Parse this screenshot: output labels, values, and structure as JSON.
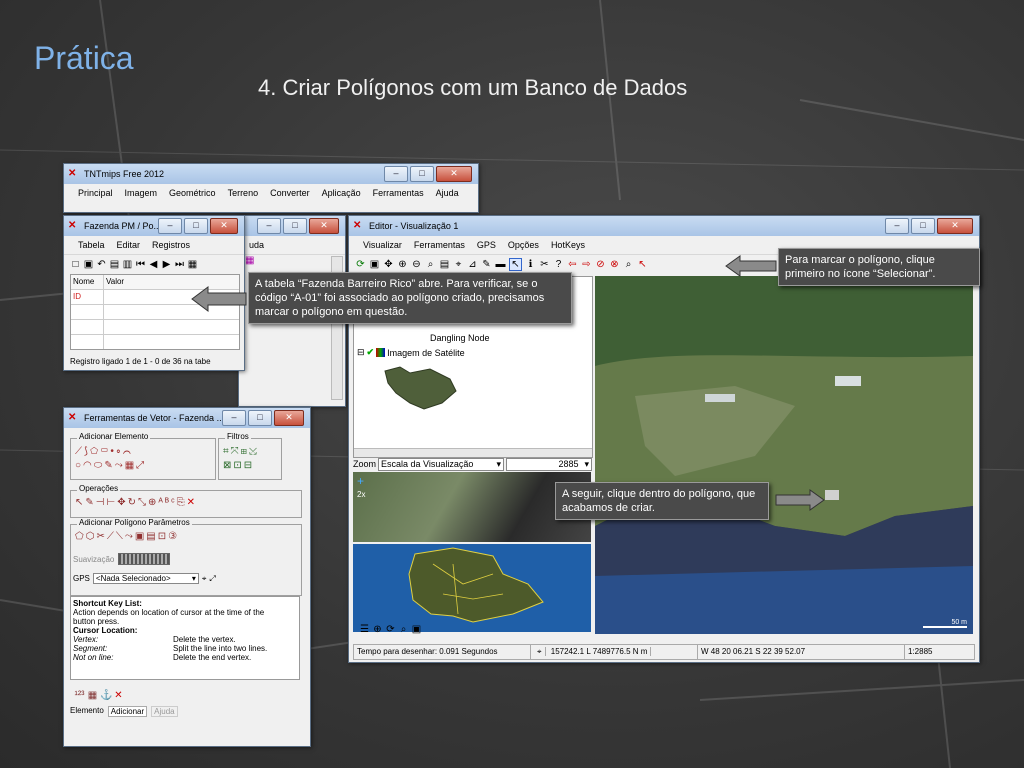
{
  "slide": {
    "title": "Prática",
    "subtitle": "4. Criar Polígonos com um Banco de Dados"
  },
  "main_window": {
    "title": "TNTmips Free 2012",
    "menu": [
      "Principal",
      "Imagem",
      "Geométrico",
      "Terreno",
      "Converter",
      "Aplicação",
      "Ferramentas",
      "Ajuda"
    ]
  },
  "behind_window": {
    "menu_fragment": "uda"
  },
  "table_window": {
    "title": "Fazenda PM / Po...",
    "menu": [
      "Tabela",
      "Editar",
      "Registros"
    ],
    "col_name": "Nome",
    "col_value": "Valor",
    "row1_name": "ID",
    "status": "Registro ligado 1 de 1 - 0 de 36 na tabe"
  },
  "editor_window": {
    "title": "Editor - Visualização 1",
    "menu": [
      "Visualizar",
      "Ferramentas",
      "GPS",
      "Opções",
      "HotKeys"
    ],
    "layer_dangling": "Dangling Node",
    "layer_satellite": "Imagem de Satélite",
    "zoom_label": "Zoom",
    "zoom_mode": "Escala da Visualização",
    "zoom_value": "2885",
    "zoom_side_label": "2x",
    "scale_label": "50 m",
    "status_time": "Tempo para desenhar: 0.091 Segundos",
    "status_coords": "157242.1 L  7489776.5 N m",
    "status_latlon": "W 48 20 06.21  S 22 39 52.07",
    "status_scale": "1:2885"
  },
  "vector_window": {
    "title": "Ferramentas de Vetor - Fazenda ...",
    "group_add": "Adicionar Elemento",
    "group_filters": "Filtros",
    "group_ops": "Operações",
    "group_poly": "Adicionar Polígono Parâmetros",
    "smooth_label": "Suavização",
    "gps_label": "GPS",
    "gps_value": "<Nada Selecionado>",
    "shortcut_title": "Shortcut Key List:",
    "shortcut_desc": "Action depends on location of cursor at the time of the button press.",
    "cursor_location": "Cursor Location:",
    "shortcuts": [
      {
        "key": "Vertex:",
        "action": "Delete the vertex."
      },
      {
        "key": "Segment:",
        "action": "Split the line into two lines."
      },
      {
        "key": "Not on line:",
        "action": "Delete the end vertex."
      }
    ],
    "tabs": [
      "Elemento",
      "Adicionar",
      "Ajuda"
    ]
  },
  "callouts": {
    "table": "A tabela “Fazenda Barreiro Rico” abre. Para verificar, se o código “A-01” foi associado ao polígono criado, precisamos marcar o polígono em questão.",
    "select": "Para marcar o polígono, clique primeiro no ícone “Selecionar”.",
    "click_inside": "A seguir, clique dentro do polígono, que acabamos de criar."
  },
  "colors": {
    "title_blue": "#7fb2e8",
    "callout_bg": "#4a4a4a",
    "id_red": "#d02020"
  }
}
